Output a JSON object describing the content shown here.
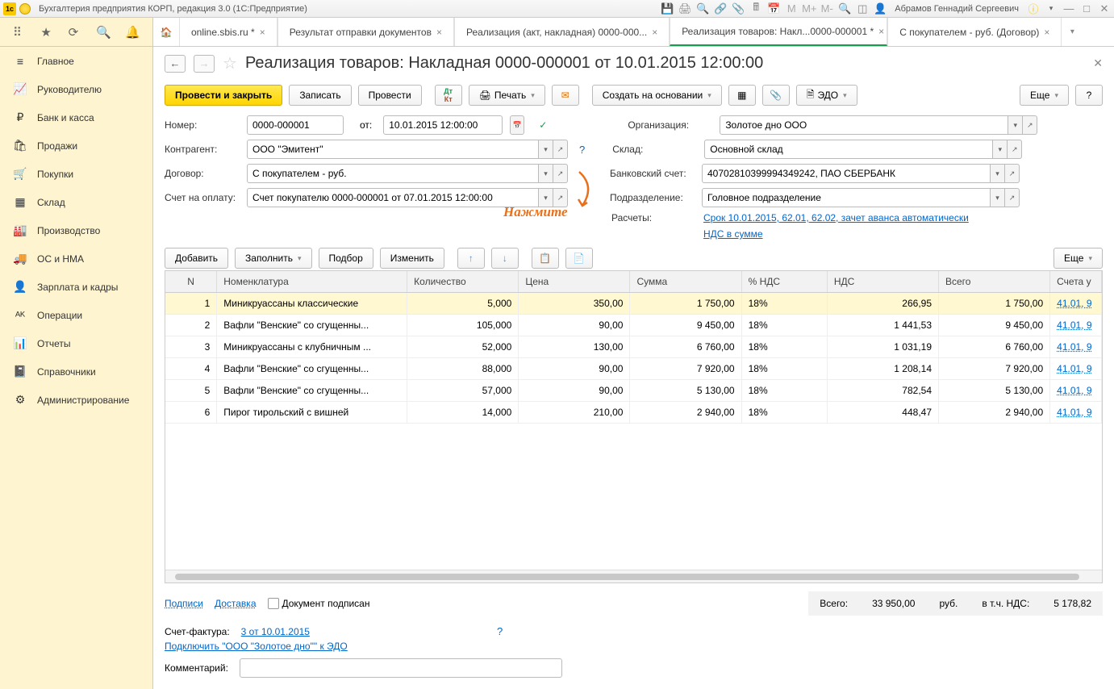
{
  "titlebar": {
    "title": "Бухгалтерия предприятия КОРП, редакция 3.0  (1С:Предприятие)",
    "user": "Абрамов Геннадий Сергеевич",
    "m_labels": [
      "М",
      "М+",
      "М-"
    ]
  },
  "sidebar": {
    "items": [
      {
        "icon": "≡",
        "label": "Главное"
      },
      {
        "icon": "📈",
        "label": "Руководителю"
      },
      {
        "icon": "₽",
        "label": "Банк и касса"
      },
      {
        "icon": "🛍",
        "label": "Продажи"
      },
      {
        "icon": "🛒",
        "label": "Покупки"
      },
      {
        "icon": "▦",
        "label": "Склад"
      },
      {
        "icon": "🏭",
        "label": "Производство"
      },
      {
        "icon": "🚚",
        "label": "ОС и НМА"
      },
      {
        "icon": "👤",
        "label": "Зарплата и кадры"
      },
      {
        "icon": "ᴬᴷ",
        "label": "Операции"
      },
      {
        "icon": "📊",
        "label": "Отчеты"
      },
      {
        "icon": "📓",
        "label": "Справочники"
      },
      {
        "icon": "⚙",
        "label": "Администрирование"
      }
    ]
  },
  "tabs": [
    {
      "label": "online.sbis.ru *",
      "active": false
    },
    {
      "label": "Результат отправки документов",
      "active": false
    },
    {
      "label": "Реализация (акт, накладная) 0000-000...",
      "active": false
    },
    {
      "label": "Реализация товаров: Накл...0000-000001 *",
      "active": true
    },
    {
      "label": "С покупателем - руб. (Договор)",
      "active": false
    }
  ],
  "page": {
    "title": "Реализация товаров: Накладная 0000-000001 от 10.01.2015 12:00:00"
  },
  "toolbar": {
    "post_close": "Провести и закрыть",
    "save": "Записать",
    "post": "Провести",
    "print": "Печать",
    "create_based": "Создать на основании",
    "edo": "ЭДО",
    "more": "Еще"
  },
  "form": {
    "number_label": "Номер:",
    "number": "0000-000001",
    "from_label": "от:",
    "date": "10.01.2015 12:00:00",
    "contragent_label": "Контрагент:",
    "contragent": "ООО \"Эмитент\"",
    "contract_label": "Договор:",
    "contract": "С покупателем - руб.",
    "invoice_label": "Счет на оплату:",
    "invoice": "Счет покупателю 0000-000001 от 07.01.2015 12:00:00",
    "org_label": "Организация:",
    "org": "Золотое дно ООО",
    "warehouse_label": "Склад:",
    "warehouse": "Основной склад",
    "bank_label": "Банковский счет:",
    "bank": "40702810399994349242, ПАО СБЕРБАНК",
    "dept_label": "Подразделение:",
    "dept": "Головное подразделение",
    "calc_label": "Расчеты:",
    "calc_link": "Срок 10.01.2015, 62.01, 62.02, зачет аванса автоматически",
    "nds_link": "НДС в сумме",
    "annotation": "Нажмите"
  },
  "ttoolbar": {
    "add": "Добавить",
    "fill": "Заполнить",
    "pick": "Подбор",
    "edit": "Изменить",
    "more": "Еще"
  },
  "table": {
    "headers": [
      "N",
      "Номенклатура",
      "Количество",
      "Цена",
      "Сумма",
      "% НДС",
      "НДС",
      "Всего",
      "Счета у"
    ],
    "rows": [
      {
        "n": 1,
        "name": "Миникруассаны классические",
        "qty": "5,000",
        "price": "350,00",
        "sum": "1 750,00",
        "vat_p": "18%",
        "vat": "266,95",
        "total": "1 750,00",
        "acct": "41.01, 9"
      },
      {
        "n": 2,
        "name": "Вафли \"Венские\" со сгущенны...",
        "qty": "105,000",
        "price": "90,00",
        "sum": "9 450,00",
        "vat_p": "18%",
        "vat": "1 441,53",
        "total": "9 450,00",
        "acct": "41.01, 9"
      },
      {
        "n": 3,
        "name": "Миникруассаны с клубничным ...",
        "qty": "52,000",
        "price": "130,00",
        "sum": "6 760,00",
        "vat_p": "18%",
        "vat": "1 031,19",
        "total": "6 760,00",
        "acct": "41.01, 9"
      },
      {
        "n": 4,
        "name": "Вафли \"Венские\" со сгущенны...",
        "qty": "88,000",
        "price": "90,00",
        "sum": "7 920,00",
        "vat_p": "18%",
        "vat": "1 208,14",
        "total": "7 920,00",
        "acct": "41.01, 9"
      },
      {
        "n": 5,
        "name": "Вафли \"Венские\" со сгущенны...",
        "qty": "57,000",
        "price": "90,00",
        "sum": "5 130,00",
        "vat_p": "18%",
        "vat": "782,54",
        "total": "5 130,00",
        "acct": "41.01, 9"
      },
      {
        "n": 6,
        "name": "Пирог тирольский с вишней",
        "qty": "14,000",
        "price": "210,00",
        "sum": "2 940,00",
        "vat_p": "18%",
        "vat": "448,47",
        "total": "2 940,00",
        "acct": "41.01, 9"
      }
    ]
  },
  "footer": {
    "signatures": "Подписи",
    "delivery": "Доставка",
    "signed": "Документ подписан",
    "total_label": "Всего:",
    "total": "33 950,00",
    "currency": "руб.",
    "vat_label": "в т.ч. НДС:",
    "vat": "5 178,82",
    "sf_label": "Счет-фактура:",
    "sf_link": "3 от 10.01.2015",
    "edo_link": "Подключить \"ООО \"Золотое дно\"\" к ЭДО",
    "comment_label": "Комментарий:"
  }
}
